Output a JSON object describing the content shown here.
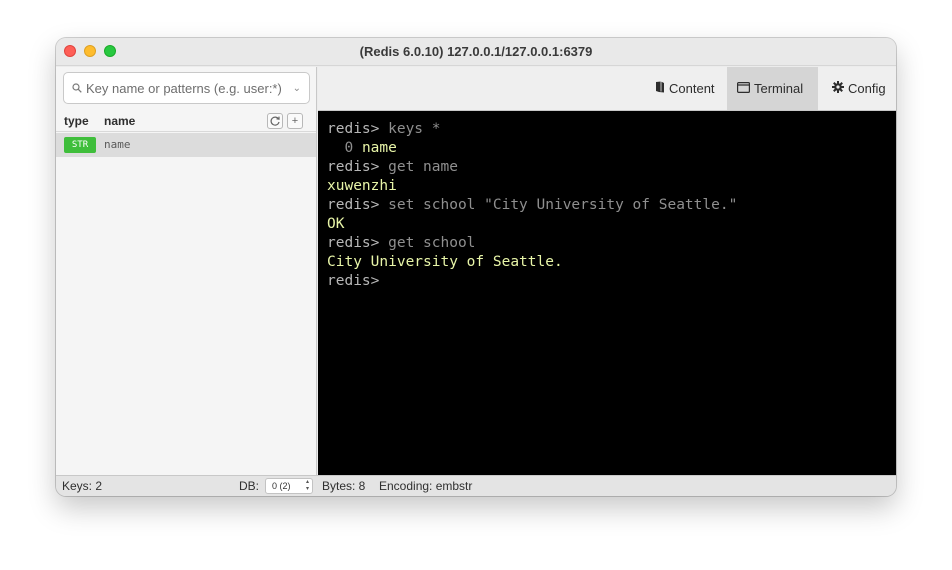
{
  "window": {
    "title": "(Redis 6.0.10) 127.0.0.1/127.0.0.1:6379"
  },
  "sidebar": {
    "search_placeholder": "Key name or patterns (e.g. user:*)",
    "columns": {
      "type": "type",
      "name": "name"
    },
    "refresh_icon": "refresh-icon",
    "add_icon": "plus-icon",
    "add_label": "+",
    "keys": [
      {
        "type": "STR",
        "name": "name",
        "type_color": "#3fbe3b"
      }
    ]
  },
  "toolbar": {
    "tabs": [
      {
        "label": "Content",
        "icon": "document-icon"
      },
      {
        "label": "Terminal",
        "icon": "window-icon",
        "active": true
      },
      {
        "label": "Config",
        "icon": "gear-icon"
      }
    ]
  },
  "terminal": {
    "lines": [
      {
        "prompt": "redis> ",
        "cmd": "keys *"
      },
      {
        "index": "0",
        "out": "name"
      },
      {
        "prompt": "redis> ",
        "cmd": "get name"
      },
      {
        "out": "xuwenzhi"
      },
      {
        "prompt": "redis> ",
        "cmd": "set school \"City University of Seattle.\""
      },
      {
        "out": "OK"
      },
      {
        "prompt": "redis> ",
        "cmd": "get school"
      },
      {
        "out": "City University of Seattle."
      },
      {
        "prompt": "redis>"
      }
    ],
    "colors": {
      "background": "#000000",
      "output": "#e8f5a8",
      "command": "#8f8f8f"
    }
  },
  "status": {
    "keys": "Keys: 2",
    "db_label": "DB:",
    "db_value": "0 (2)",
    "bytes": "Bytes: 8",
    "encoding": "Encoding: embstr"
  }
}
